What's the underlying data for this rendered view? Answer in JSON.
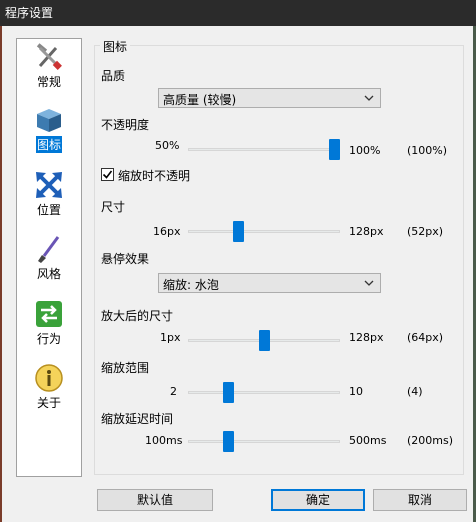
{
  "window": {
    "title": "程序设置"
  },
  "sidebar": {
    "items": [
      {
        "label": "常规",
        "icon": "tools-icon"
      },
      {
        "label": "图标",
        "icon": "box-icon",
        "active": true
      },
      {
        "label": "位置",
        "icon": "arrows-icon"
      },
      {
        "label": "风格",
        "icon": "brush-icon"
      },
      {
        "label": "行为",
        "icon": "exchange-icon"
      },
      {
        "label": "关于",
        "icon": "info-icon"
      }
    ]
  },
  "group": {
    "title": "图标"
  },
  "quality": {
    "label": "品质",
    "value": "高质量 (较慢)"
  },
  "opacity": {
    "label": "不透明度",
    "min": "50%",
    "max": "100%",
    "current": "(100%)",
    "level": 1.0
  },
  "opaque_zoom": {
    "label": "缩放时不透明",
    "checked": true
  },
  "size": {
    "label": "尺寸",
    "min": "16px",
    "max": "128px",
    "current": "(52px)",
    "level": 0.32
  },
  "hover": {
    "label": "悬停效果",
    "value": "缩放: 水泡"
  },
  "zoom_size": {
    "label": "放大后的尺寸",
    "min": "1px",
    "max": "128px",
    "current": "(64px)",
    "level": 0.5
  },
  "zoom_range": {
    "label": "缩放范围",
    "min": "2",
    "max": "10",
    "current": "(4)",
    "level": 0.25
  },
  "zoom_delay": {
    "label": "缩放延迟时间",
    "min": "100ms",
    "max": "500ms",
    "current": "(200ms)",
    "level": 0.25
  },
  "buttons": {
    "default": "默认值",
    "ok": "确定",
    "cancel": "取消"
  },
  "colors": {
    "accent": "#0078d7",
    "titlebar": "#2b2b2b"
  }
}
